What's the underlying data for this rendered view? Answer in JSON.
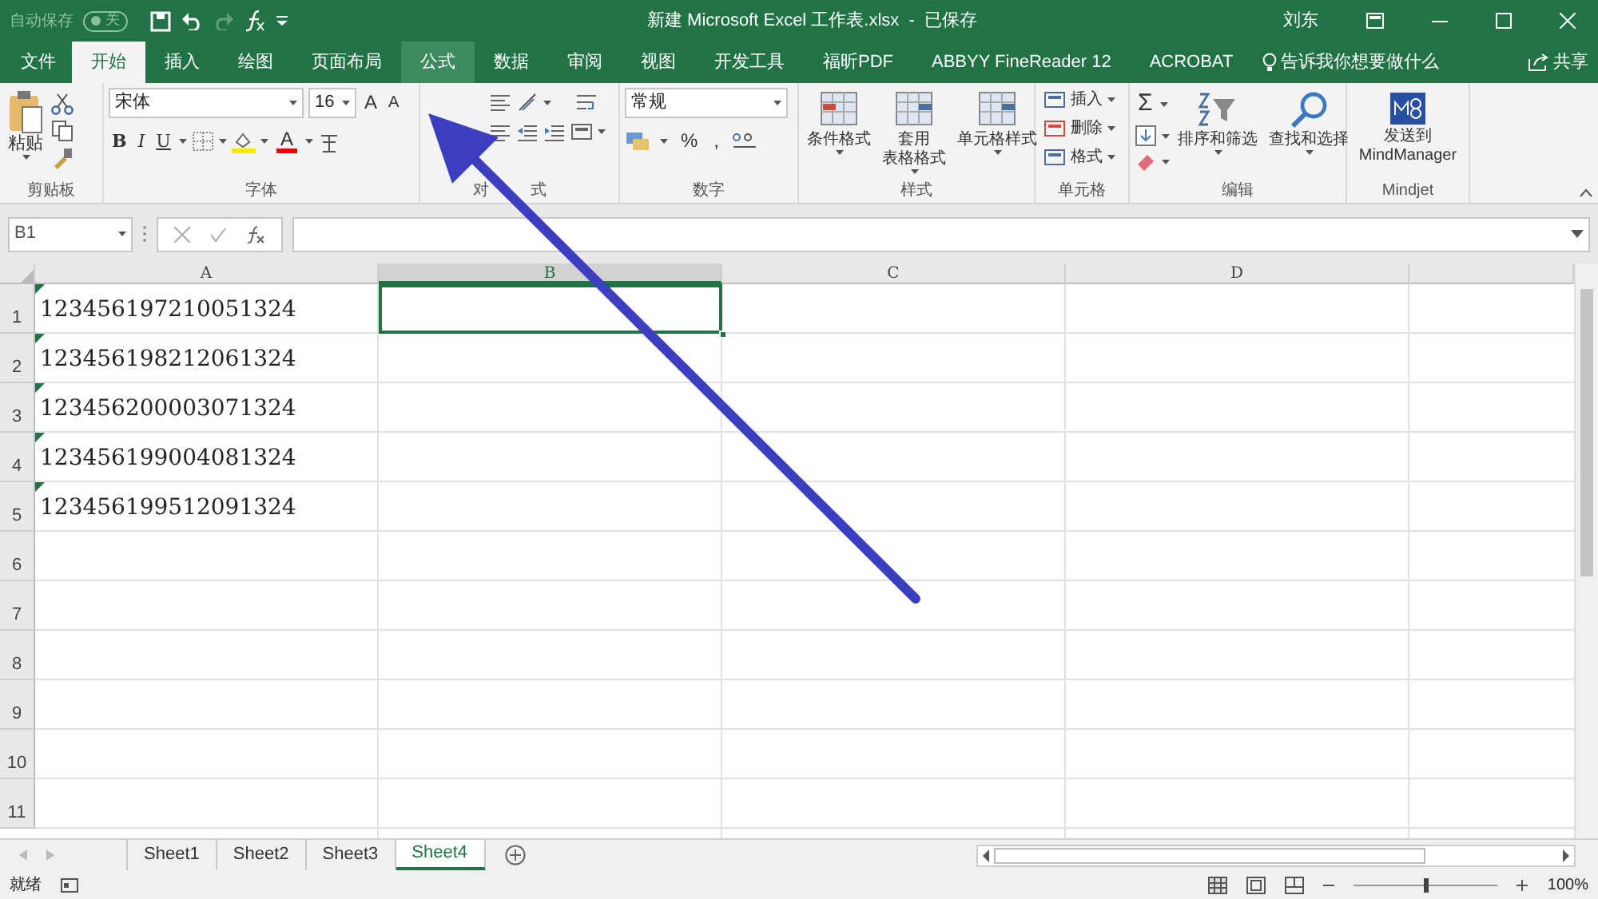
{
  "title_bar": {
    "autosave_label": "自动保存",
    "autosave_toggle": {
      "on": false,
      "label": "关"
    },
    "title": "新建 Microsoft Excel 工作表.xlsx  -  已保存",
    "user": "刘东"
  },
  "ribbon_tabs": [
    {
      "label": "文件",
      "selected": false,
      "hovered": false
    },
    {
      "label": "开始",
      "selected": true,
      "hovered": false
    },
    {
      "label": "插入",
      "selected": false,
      "hovered": false
    },
    {
      "label": "绘图",
      "selected": false,
      "hovered": false
    },
    {
      "label": "页面布局",
      "selected": false,
      "hovered": false
    },
    {
      "label": "公式",
      "selected": false,
      "hovered": true
    },
    {
      "label": "数据",
      "selected": false,
      "hovered": false
    },
    {
      "label": "审阅",
      "selected": false,
      "hovered": false
    },
    {
      "label": "视图",
      "selected": false,
      "hovered": false
    },
    {
      "label": "开发工具",
      "selected": false,
      "hovered": false
    },
    {
      "label": "福昕PDF",
      "selected": false,
      "hovered": false
    },
    {
      "label": "ABBYY FineReader 12",
      "selected": false,
      "hovered": false
    },
    {
      "label": "ACROBAT",
      "selected": false,
      "hovered": false
    }
  ],
  "tell_me": "告诉我你想要做什么",
  "share": "共享",
  "ribbon_groups": [
    {
      "kind": "clipboard",
      "label": "剪贴板",
      "paste": "粘贴"
    },
    {
      "kind": "font",
      "label": "字体",
      "font": "宋体",
      "size": "16",
      "grow": "A",
      "shrink": "A",
      "styles": [
        "B",
        "I",
        "U"
      ],
      "font_color": "A"
    },
    {
      "kind": "alignment",
      "label_parts": [
        "对",
        "式"
      ]
    },
    {
      "kind": "number",
      "label": "数字",
      "format": "常规",
      "percent": "%",
      "comma": ","
    },
    {
      "kind": "styles",
      "label": "样式",
      "buttons": [
        [
          "条件格式"
        ],
        [
          "套用",
          "表格格式"
        ],
        [
          "单元格样式"
        ]
      ]
    },
    {
      "kind": "cells",
      "label": "单元格",
      "buttons": [
        "插入",
        "删除",
        "格式"
      ]
    },
    {
      "kind": "editing",
      "label": "编辑",
      "sum": "Σ",
      "buttons": [
        "排序和筛选",
        "查找和选择"
      ]
    },
    {
      "kind": "addin",
      "label": "Mindjet",
      "button": "发送到\nMindManager"
    }
  ],
  "name_box": "B1",
  "columns": [
    "A",
    "B",
    "C",
    "D",
    ""
  ],
  "rows": [
    {
      "header": "1",
      "cells": [
        {
          "value": "123456197210051324",
          "flag": true,
          "selected": false
        },
        {
          "selected": true
        }
      ]
    },
    {
      "header": "2",
      "cells": [
        {
          "value": "123456198212061324",
          "flag": true,
          "selected": false
        }
      ]
    },
    {
      "header": "3",
      "cells": [
        {
          "value": "123456200003071324",
          "flag": true,
          "selected": false
        }
      ]
    },
    {
      "header": "4",
      "cells": [
        {
          "value": "123456199004081324",
          "flag": true,
          "selected": false
        }
      ]
    },
    {
      "header": "5",
      "cells": [
        {
          "value": "123456199512091324",
          "flag": true,
          "selected": false
        }
      ]
    },
    {
      "header": "6",
      "cells": []
    },
    {
      "header": "7",
      "cells": []
    },
    {
      "header": "8",
      "cells": []
    },
    {
      "header": "9",
      "cells": []
    },
    {
      "header": "10",
      "cells": []
    },
    {
      "header": "11",
      "cells": []
    }
  ],
  "sheets": [
    {
      "label": "Sheet1",
      "selected": false
    },
    {
      "label": "Sheet2",
      "selected": false
    },
    {
      "label": "Sheet3",
      "selected": false
    },
    {
      "label": "Sheet4",
      "selected": true
    }
  ],
  "status": "就绪",
  "zoom": {
    "level": 0.5,
    "reading": "100%"
  }
}
